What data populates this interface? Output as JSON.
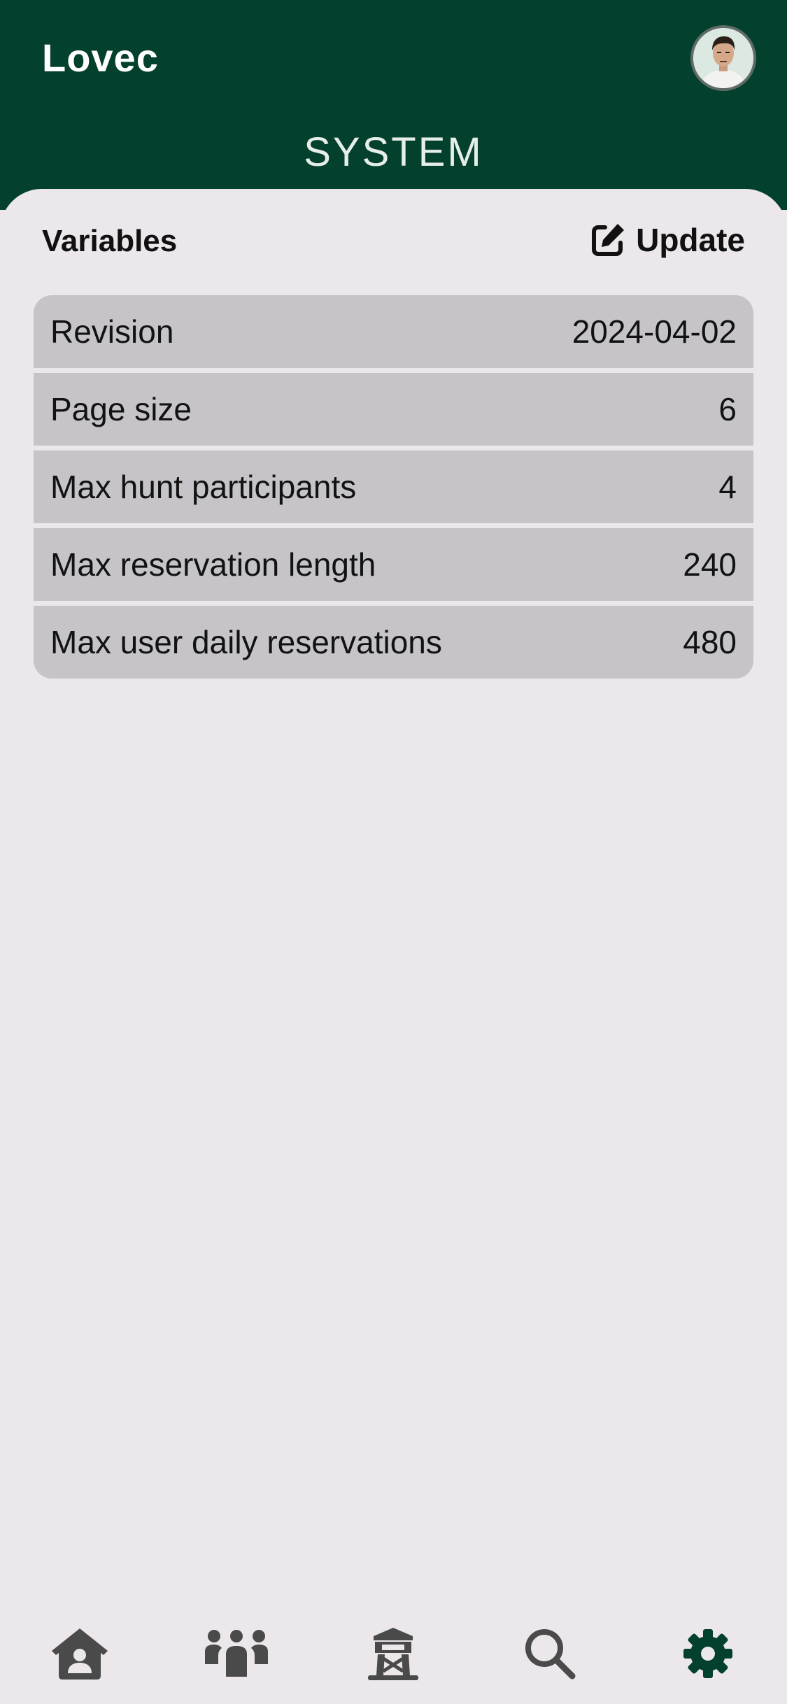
{
  "header": {
    "app_title": "Lovec",
    "page_title": "SYSTEM"
  },
  "variables": {
    "section_title": "Variables",
    "update_label": "Update",
    "rows": [
      {
        "name": "Revision",
        "value": "2024-04-02"
      },
      {
        "name": "Page size",
        "value": "6"
      },
      {
        "name": "Max hunt participants",
        "value": "4"
      },
      {
        "name": "Max reservation length",
        "value": "240"
      },
      {
        "name": "Max user daily reservations",
        "value": "480"
      }
    ]
  },
  "nav": {
    "items": [
      {
        "icon": "home-user-icon",
        "active": false
      },
      {
        "icon": "people-group-icon",
        "active": false
      },
      {
        "icon": "hunting-tower-icon",
        "active": false
      },
      {
        "icon": "search-icon",
        "active": false
      },
      {
        "icon": "gear-icon",
        "active": true
      }
    ]
  },
  "colors": {
    "brand_green": "#04402E",
    "background": "#EBE7EB",
    "row_background": "#C6C4C8",
    "nav_icon_inactive": "#4A4A4A",
    "nav_icon_active": "#04402E"
  }
}
